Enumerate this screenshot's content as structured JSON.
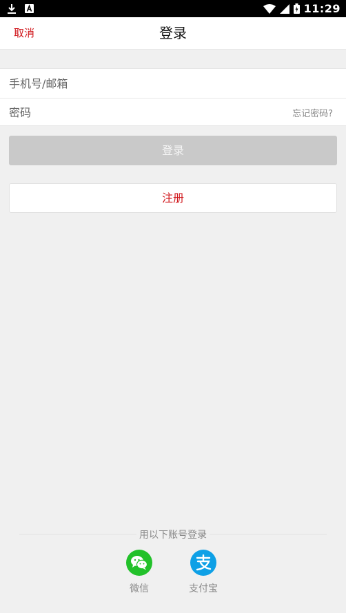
{
  "status_bar": {
    "time": "11:29",
    "icons": [
      "download-icon",
      "a-notification-icon",
      "wifi-icon",
      "signal-icon",
      "battery-icon"
    ]
  },
  "header": {
    "cancel_label": "取消",
    "title": "登录"
  },
  "form": {
    "account_placeholder": "手机号/邮箱",
    "account_value": "",
    "password_placeholder": "密码",
    "password_value": "",
    "forgot_label": "忘记密码?"
  },
  "actions": {
    "login_label": "登录",
    "register_label": "注册"
  },
  "third_party": {
    "label": "用以下账号登录",
    "providers": [
      {
        "name": "微信",
        "icon": "wechat-icon",
        "color": "#22c12a"
      },
      {
        "name": "支付宝",
        "icon": "alipay-icon",
        "color": "#0ea0e6"
      }
    ]
  },
  "colors": {
    "accent": "#d0161b",
    "disabled_button": "#c9c9c9",
    "background": "#f0f0f0"
  }
}
